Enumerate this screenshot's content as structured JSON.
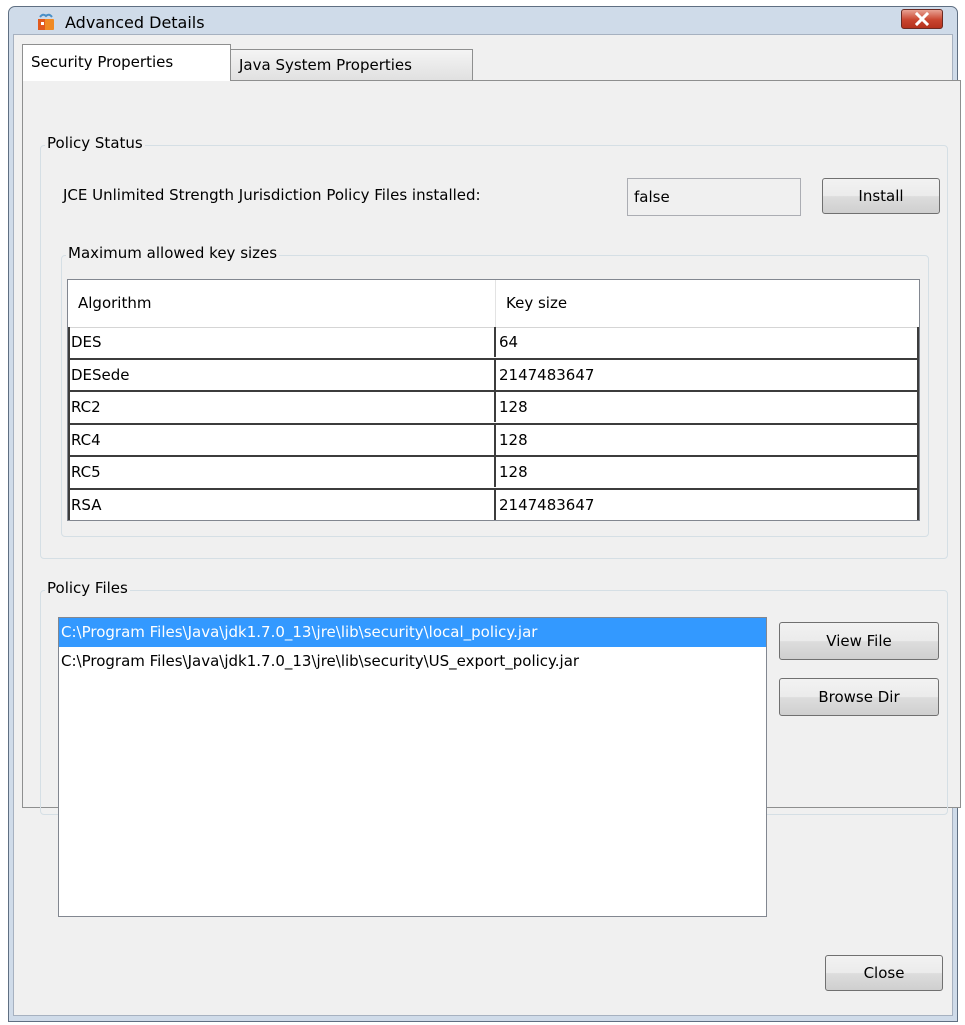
{
  "window": {
    "title": "Advanced Details",
    "icon": "java-app-icon",
    "close_icon": "close-icon"
  },
  "tabs": [
    {
      "label": "Security Properties",
      "selected": true
    },
    {
      "label": "Java System Properties",
      "selected": false
    }
  ],
  "policy_status": {
    "legend": "Policy Status",
    "jce_label": "JCE Unlimited Strength Jurisdiction Policy Files installed:",
    "jce_value": "false",
    "install_label": "Install",
    "key_sizes": {
      "legend": "Maximum allowed key sizes",
      "columns": [
        "Algorithm",
        "Key size"
      ],
      "rows": [
        [
          "DES",
          "64"
        ],
        [
          "DESede",
          "2147483647"
        ],
        [
          "RC2",
          "128"
        ],
        [
          "RC4",
          "128"
        ],
        [
          "RC5",
          "128"
        ],
        [
          "RSA",
          "2147483647"
        ]
      ]
    }
  },
  "policy_files": {
    "legend": "Policy Files",
    "files": [
      "C:\\Program Files\\Java\\jdk1.7.0_13\\jre\\lib\\security\\local_policy.jar",
      "C:\\Program Files\\Java\\jdk1.7.0_13\\jre\\lib\\security\\US_export_policy.jar"
    ],
    "selected_index": 0,
    "view_file_label": "View File",
    "browse_dir_label": "Browse Dir"
  },
  "close_label": "Close",
  "colors": {
    "selection": "#3399ff",
    "window_frame": "#cfdbe9",
    "client_bg": "#f0f0f0"
  }
}
